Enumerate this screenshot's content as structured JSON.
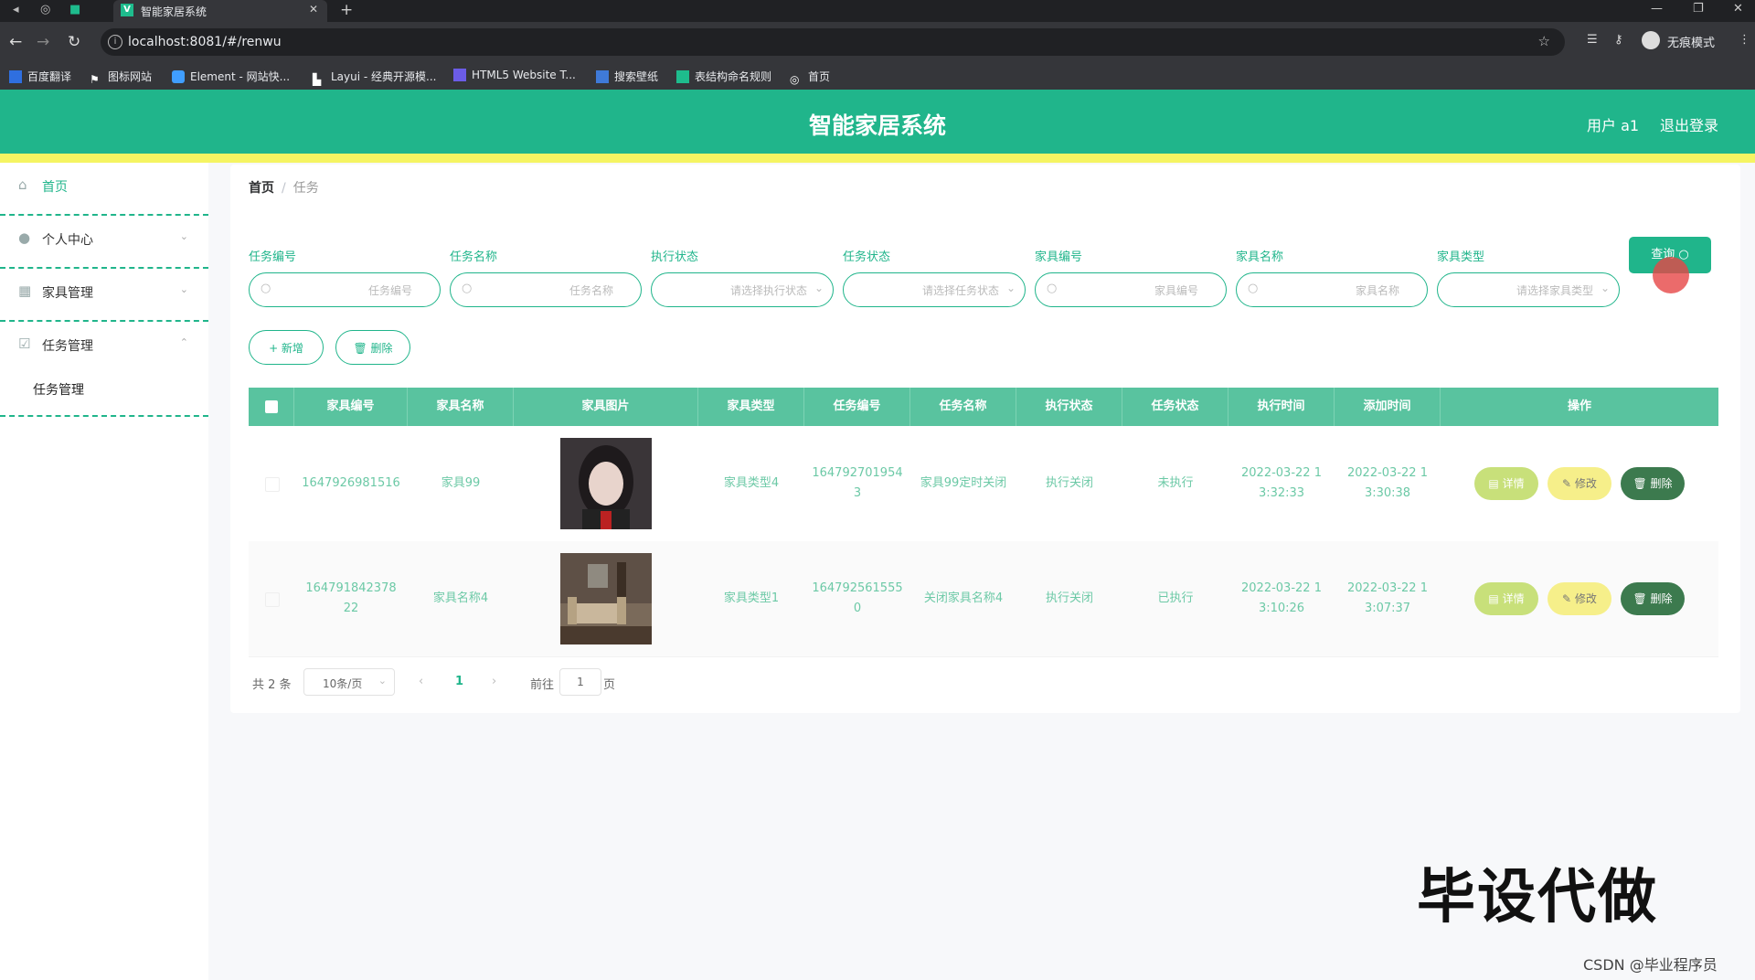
{
  "browser": {
    "tab_title": "智能家居系统",
    "url": "localhost:8081/#/renwu",
    "incognito_label": "无痕模式",
    "bookmarks": [
      "百度翻译",
      "图标网站",
      "Element - 网站快...",
      "Layui - 经典开源模...",
      "HTML5 Website T...",
      "搜索壁纸",
      "表结构命名规则",
      "首页"
    ]
  },
  "header": {
    "title": "智能家居系统",
    "user": "用户 a1",
    "logout": "退出登录"
  },
  "sidebar": {
    "items": [
      {
        "label": "首页",
        "icon": "home-icon"
      },
      {
        "label": "个人中心",
        "icon": "user-icon"
      },
      {
        "label": "家具管理",
        "icon": "grid-icon"
      },
      {
        "label": "任务管理",
        "icon": "check-square-icon"
      }
    ],
    "sub_item": "任务管理"
  },
  "breadcrumb": {
    "home": "首页",
    "separator": "/",
    "current": "任务"
  },
  "filters": [
    {
      "label": "任务编号",
      "placeholder": "任务编号",
      "type": "input"
    },
    {
      "label": "任务名称",
      "placeholder": "任务名称",
      "type": "input"
    },
    {
      "label": "执行状态",
      "placeholder": "请选择执行状态",
      "type": "select"
    },
    {
      "label": "任务状态",
      "placeholder": "请选择任务状态",
      "type": "select"
    },
    {
      "label": "家具编号",
      "placeholder": "家具编号",
      "type": "input"
    },
    {
      "label": "家具名称",
      "placeholder": "家具名称",
      "type": "input"
    },
    {
      "label": "家具类型",
      "placeholder": "请选择家具类型",
      "type": "select"
    }
  ],
  "buttons": {
    "query": "查询",
    "add": "+ 新增",
    "delete": "删除"
  },
  "table": {
    "columns": [
      "家具编号",
      "家具名称",
      "家具图片",
      "家具类型",
      "任务编号",
      "任务名称",
      "执行状态",
      "任务状态",
      "执行时间",
      "添加时间",
      "操作"
    ],
    "rows": [
      {
        "furniture_no": "1647926981516",
        "furniture_name": "家具99",
        "furniture_type": "家具类型4",
        "task_no": "1647927019543",
        "task_name": "家具99定时关闭",
        "exec_status": "执行关闭",
        "task_status": "未执行",
        "exec_time": "2022-03-22 13:32:33",
        "add_time": "2022-03-22 13:30:38"
      },
      {
        "furniture_no": "164791842378 22",
        "furniture_name": "家具名称4",
        "furniture_type": "家具类型1",
        "task_no": "1647925615550",
        "task_name": "关闭家具名称4",
        "exec_status": "执行关闭",
        "task_status": "已执行",
        "exec_time": "2022-03-22 13:10:26",
        "add_time": "2022-03-22 13:07:37"
      }
    ],
    "actions": {
      "detail": "详情",
      "edit": "修改",
      "delete": "删除"
    }
  },
  "pagination": {
    "total": "共 2 条",
    "page_size": "10条/页",
    "prev": "‹",
    "current": "1",
    "next": "›",
    "goto_prefix": "前往",
    "goto_value": "1",
    "goto_suffix": "页"
  },
  "overlay": {
    "watermark": "毕设代做",
    "credit": "CSDN @毕业程序员"
  },
  "colors": {
    "primary": "#20b58b",
    "accent_bar": "#f5f462",
    "table_header": "#59c39f"
  }
}
